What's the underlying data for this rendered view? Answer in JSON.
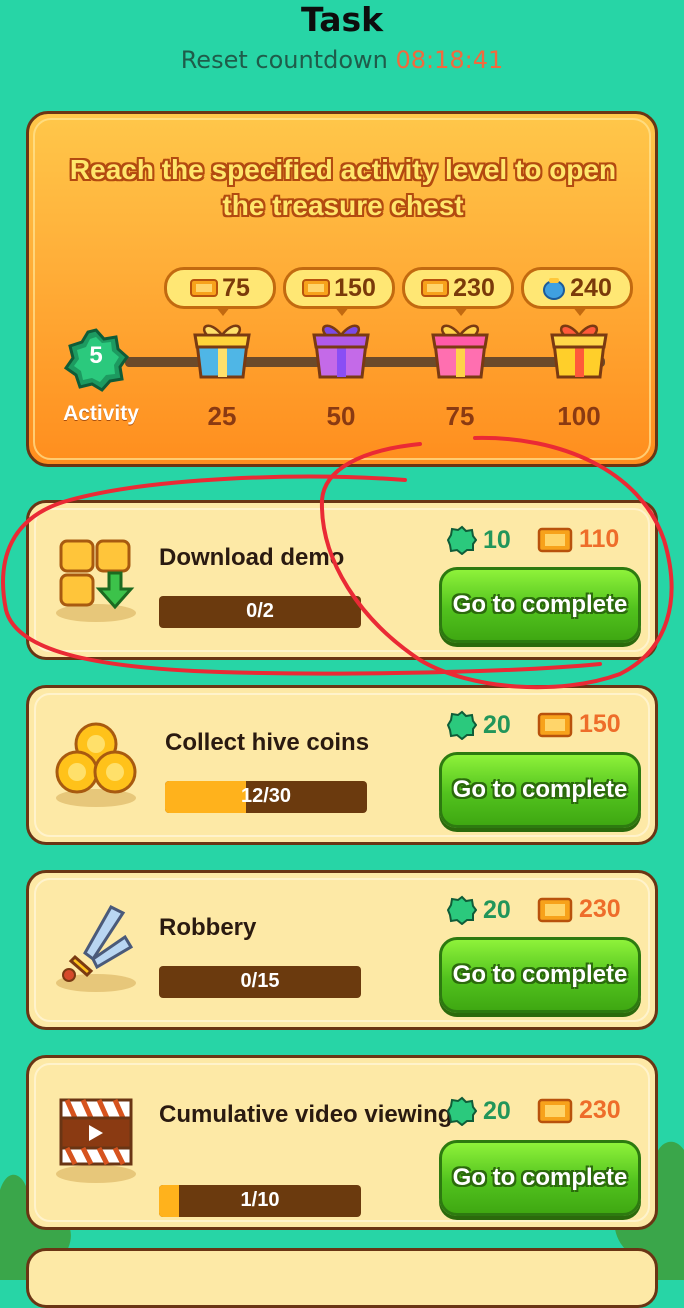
{
  "header": {
    "title": "Task",
    "countdown_label": "Reset countdown",
    "countdown_value": "08:18:41"
  },
  "activity_panel": {
    "title": "Reach the specified activity level to open the treasure chest",
    "current_activity": "5",
    "activity_label": "Activity",
    "milestones": [
      {
        "reward": "75",
        "reward_icon": "ticket-icon",
        "level": "25",
        "chest_color": "#4fb6e6"
      },
      {
        "reward": "150",
        "reward_icon": "ticket-icon",
        "level": "50",
        "chest_color": "#b45ce6"
      },
      {
        "reward": "230",
        "reward_icon": "ticket-icon",
        "level": "75",
        "chest_color": "#ff5aa8"
      },
      {
        "reward": "240",
        "reward_icon": "honey-jar-icon",
        "level": "100",
        "chest_color": "#ffcf2a"
      }
    ]
  },
  "tasks": [
    {
      "title": "Download demo",
      "progress_text": "0/2",
      "progress": 0.0,
      "green_reward": "10",
      "orange_reward": "110",
      "button": "Go to complete",
      "icon": "download-blocks-icon"
    },
    {
      "title": "Collect hive coins",
      "progress_text": "12/30",
      "progress": 0.4,
      "green_reward": "20",
      "orange_reward": "150",
      "button": "Go to complete",
      "icon": "coins-icon"
    },
    {
      "title": "Robbery",
      "progress_text": "0/15",
      "progress": 0.0,
      "green_reward": "20",
      "orange_reward": "230",
      "button": "Go to complete",
      "icon": "sword-icon"
    },
    {
      "title": "Cumulative video viewing",
      "progress_text": "1/10",
      "progress": 0.1,
      "green_reward": "20",
      "orange_reward": "230",
      "button": "Go to complete",
      "icon": "clapperboard-icon"
    }
  ],
  "colors": {
    "background": "#27d5a6",
    "annotation": "#ea2a35",
    "button_green": "#52c21e"
  }
}
